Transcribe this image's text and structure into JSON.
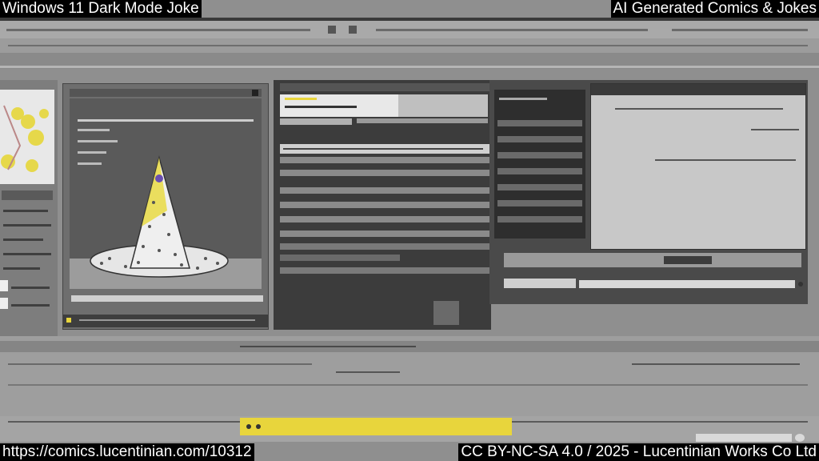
{
  "captions": {
    "title": "Windows 11 Dark Mode Joke",
    "series": "AI Generated Comics & Jokes",
    "url": "https://comics.lucentinian.com/10312",
    "license": "CC BY-NC-SA 4.0 / 2025 - Lucentinian Works Co Ltd"
  },
  "taskbar": {
    "accent_color": "#e8d53c"
  },
  "colors": {
    "desktop": "#8f8f8f",
    "window_dark": "#3a3a3a",
    "window_light": "#c8c8c8",
    "hat_yellow": "#e9dc4e",
    "hat_dot": "#6a4fb0"
  }
}
